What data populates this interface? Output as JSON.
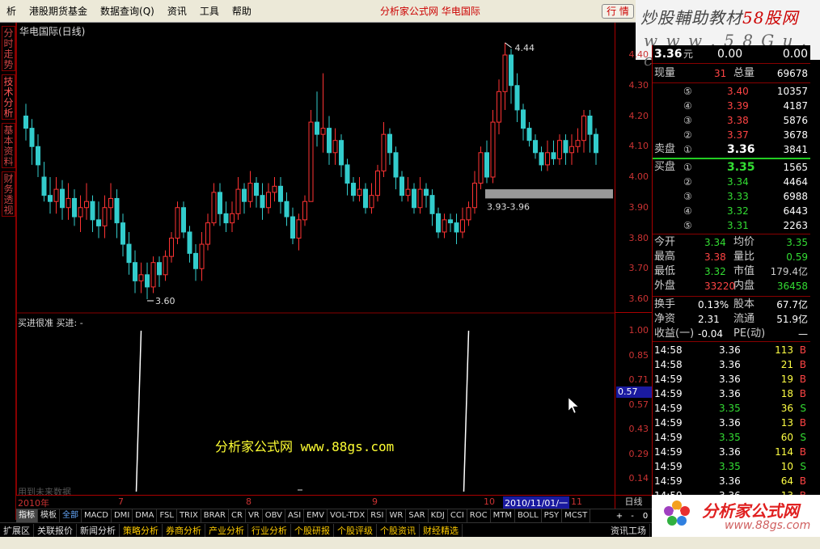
{
  "menu": {
    "items": [
      "析",
      "港股期货基金",
      "数据查询(Q)",
      "资讯",
      "工具",
      "帮助"
    ],
    "title": "分析家公式网  华电国际",
    "quote_button": "行 情"
  },
  "top_logo": {
    "line1_a": "炒股輔助教材",
    "line1_b": "58股网",
    "line2": "w w w . 5 8 G u . c o m"
  },
  "left_tabs": [
    "分时走势",
    "技术分析",
    "基本资料",
    "财务透视"
  ],
  "chart": {
    "title": "华电国际(日线)",
    "high_label": "4.44",
    "low_label": "3.60",
    "box_label": "3.93-3.96",
    "indicator_title": "买进很准 买进: -",
    "watermark_a": "分析家公式网 ",
    "watermark_b": "www.88gs.com",
    "future_note": "用到未来数据",
    "indicator_marker": "0.57",
    "colors": {
      "up": "#ff3333",
      "down": "#33cccc",
      "box": "#999999",
      "line": "#ffffff",
      "grid": "#880000"
    }
  },
  "chart_data": {
    "type": "candlestick",
    "price_axis": [
      "4.40",
      "4.30",
      "4.20",
      "4.10",
      "4.00",
      "3.90",
      "3.80",
      "3.70",
      "3.60"
    ],
    "indicator_axis": [
      "1.00",
      "0.85",
      "0.71",
      "0.57",
      "0.43",
      "0.29",
      "0.14"
    ],
    "x_labels": [
      "2010年",
      "7",
      "8",
      "9",
      "10",
      "11"
    ],
    "date_label": "2010/11/01/一",
    "period": "日线",
    "candles": [
      [
        4.2,
        4.16,
        4.24,
        4.12
      ],
      [
        4.16,
        4.1,
        4.19,
        4.04
      ],
      [
        4.1,
        4.04,
        4.14,
        4.0
      ],
      [
        4.0,
        3.94,
        4.05,
        3.92
      ],
      [
        3.94,
        3.92,
        4.0,
        3.88
      ],
      [
        3.92,
        3.96,
        4.0,
        3.88
      ],
      [
        3.96,
        3.9,
        3.99,
        3.86
      ],
      [
        3.9,
        3.93,
        3.98,
        3.86
      ],
      [
        3.93,
        3.87,
        3.96,
        3.84
      ],
      [
        3.87,
        3.9,
        3.94,
        3.82
      ],
      [
        3.9,
        3.92,
        3.98,
        3.86
      ],
      [
        3.92,
        3.86,
        3.94,
        3.82
      ],
      [
        3.86,
        3.84,
        3.92,
        3.8
      ],
      [
        3.84,
        3.9,
        3.94,
        3.8
      ],
      [
        3.9,
        3.93,
        3.98,
        3.86
      ],
      [
        3.93,
        3.85,
        3.96,
        3.8
      ],
      [
        3.85,
        3.78,
        3.88,
        3.74
      ],
      [
        3.78,
        3.72,
        3.82,
        3.68
      ],
      [
        3.72,
        3.66,
        3.76,
        3.62
      ],
      [
        3.66,
        3.68,
        3.72,
        3.62
      ],
      [
        3.68,
        3.64,
        3.72,
        3.6
      ],
      [
        3.64,
        3.72,
        3.74,
        3.62
      ],
      [
        3.72,
        3.68,
        3.74,
        3.64
      ],
      [
        3.68,
        3.74,
        3.76,
        3.66
      ],
      [
        3.74,
        3.8,
        3.82,
        3.72
      ],
      [
        3.8,
        3.9,
        3.92,
        3.78
      ],
      [
        3.9,
        3.82,
        3.92,
        3.8
      ],
      [
        3.82,
        3.75,
        3.84,
        3.72
      ],
      [
        3.75,
        3.7,
        3.78,
        3.66
      ],
      [
        3.7,
        3.78,
        3.82,
        3.66
      ],
      [
        3.78,
        3.85,
        3.88,
        3.76
      ],
      [
        3.85,
        3.95,
        3.98,
        3.84
      ],
      [
        3.95,
        3.88,
        3.98,
        3.84
      ],
      [
        3.88,
        3.85,
        3.92,
        3.82
      ],
      [
        3.85,
        3.88,
        3.92,
        3.82
      ],
      [
        3.88,
        3.96,
        4.0,
        3.86
      ],
      [
        3.96,
        3.92,
        3.98,
        3.88
      ],
      [
        3.92,
        3.98,
        4.02,
        3.9
      ],
      [
        3.98,
        3.94,
        4.0,
        3.9
      ],
      [
        3.94,
        3.9,
        3.98,
        3.86
      ],
      [
        3.9,
        3.95,
        3.98,
        3.88
      ],
      [
        3.95,
        3.97,
        4.0,
        3.92
      ],
      [
        3.97,
        3.92,
        4.0,
        3.88
      ],
      [
        3.92,
        3.87,
        3.95,
        3.84
      ],
      [
        3.87,
        3.8,
        3.9,
        3.78
      ],
      [
        3.8,
        3.86,
        3.88,
        3.76
      ],
      [
        3.86,
        3.92,
        3.94,
        3.84
      ],
      [
        3.92,
        4.18,
        4.22,
        3.92
      ],
      [
        4.18,
        4.14,
        4.28,
        4.1
      ],
      [
        4.14,
        4.16,
        4.34,
        4.08
      ],
      [
        4.16,
        4.08,
        4.2,
        4.04
      ],
      [
        4.08,
        4.12,
        4.16,
        4.04
      ],
      [
        4.12,
        4.04,
        4.14,
        4.0
      ],
      [
        4.04,
        3.98,
        4.06,
        3.94
      ],
      [
        3.98,
        3.94,
        4.0,
        3.92
      ],
      [
        3.94,
        3.96,
        4.0,
        3.92
      ],
      [
        3.96,
        3.9,
        3.98,
        3.88
      ],
      [
        3.9,
        3.94,
        3.98,
        3.88
      ],
      [
        3.94,
        4.02,
        4.04,
        3.92
      ],
      [
        4.02,
        4.14,
        4.18,
        4.0
      ],
      [
        4.14,
        4.08,
        4.16,
        4.04
      ],
      [
        4.08,
        4.0,
        4.1,
        3.96
      ],
      [
        4.0,
        3.94,
        4.02,
        3.92
      ],
      [
        3.94,
        3.96,
        4.0,
        3.92
      ],
      [
        3.96,
        3.9,
        3.98,
        3.88
      ],
      [
        3.9,
        3.96,
        4.0,
        3.88
      ],
      [
        3.96,
        3.94,
        3.98,
        3.9
      ],
      [
        3.94,
        3.88,
        3.96,
        3.84
      ],
      [
        3.88,
        3.82,
        3.9,
        3.8
      ],
      [
        3.82,
        3.86,
        3.88,
        3.8
      ],
      [
        3.86,
        3.85,
        3.88,
        3.82
      ],
      [
        3.85,
        3.82,
        3.88,
        3.78
      ],
      [
        3.82,
        3.86,
        3.9,
        3.8
      ],
      [
        3.86,
        3.9,
        3.92,
        3.84
      ],
      [
        3.9,
        3.98,
        4.02,
        3.88
      ],
      [
        3.98,
        4.08,
        4.1,
        3.96
      ],
      [
        4.08,
        4.0,
        4.12,
        3.98
      ],
      [
        4.0,
        4.18,
        4.22,
        3.98
      ],
      [
        4.18,
        4.28,
        4.32,
        4.14
      ],
      [
        4.28,
        4.4,
        4.44,
        4.22
      ],
      [
        4.4,
        4.3,
        4.42,
        4.24
      ],
      [
        4.3,
        4.22,
        4.34,
        4.18
      ],
      [
        4.22,
        4.16,
        4.24,
        4.12
      ],
      [
        4.16,
        4.12,
        4.18,
        4.1
      ],
      [
        4.12,
        4.08,
        4.14,
        4.06
      ],
      [
        4.08,
        4.04,
        4.1,
        4.02
      ],
      [
        4.04,
        4.08,
        4.12,
        4.02
      ],
      [
        4.08,
        4.06,
        4.12,
        4.04
      ],
      [
        4.06,
        4.12,
        4.14,
        4.04
      ],
      [
        4.12,
        4.08,
        4.14,
        4.04
      ],
      [
        4.08,
        4.1,
        4.14,
        4.04
      ],
      [
        4.1,
        4.12,
        4.16,
        4.08
      ],
      [
        4.12,
        4.2,
        4.22,
        4.08
      ],
      [
        4.2,
        4.14,
        4.22,
        4.08
      ],
      [
        4.14,
        4.08,
        4.16,
        4.04
      ]
    ],
    "signal_spikes": [
      {
        "x_index": 19
      },
      {
        "x_index": 73
      }
    ]
  },
  "indicator_bar": {
    "items": [
      "指标",
      "模板",
      "全部",
      "MACD",
      "DMI",
      "DMA",
      "FSL",
      "TRIX",
      "BRAR",
      "CR",
      "VR",
      "OBV",
      "ASI",
      "EMV",
      "VOL-TDX",
      "RSI",
      "WR",
      "SAR",
      "KDJ",
      "CCI",
      "ROC",
      "MTM",
      "BOLL",
      "PSY",
      "MCST"
    ],
    "controls": [
      "+",
      "-",
      "0"
    ]
  },
  "bottom_bar": {
    "items": [
      "扩展区",
      "关联报价",
      "新闻分析",
      "策略分析",
      "券商分析",
      "产业分析",
      "行业分析",
      "个股研报",
      "个股评级",
      "个股资讯",
      "财经精选"
    ],
    "right": "资讯工场"
  },
  "quote": {
    "price": "3.36",
    "unit": "元",
    "change": "0.00",
    "pct": "0.00",
    "now_label": "现量",
    "now_val": "31",
    "total_label": "总量",
    "total_val": "69678",
    "asks": [
      {
        "lv": "⑤",
        "p": "3.40",
        "v": "10357"
      },
      {
        "lv": "④",
        "p": "3.39",
        "v": "4187"
      },
      {
        "lv": "③",
        "p": "3.38",
        "v": "5876"
      },
      {
        "lv": "②",
        "p": "3.37",
        "v": "3678"
      },
      {
        "lv": "①",
        "p": "3.36",
        "v": "3841"
      }
    ],
    "ask_label": "卖盘",
    "bid_label": "买盘",
    "bids": [
      {
        "lv": "①",
        "p": "3.35",
        "v": "1565"
      },
      {
        "lv": "②",
        "p": "3.34",
        "v": "4464"
      },
      {
        "lv": "③",
        "p": "3.33",
        "v": "6988"
      },
      {
        "lv": "④",
        "p": "3.32",
        "v": "6443"
      },
      {
        "lv": "⑤",
        "p": "3.31",
        "v": "2263"
      }
    ],
    "stats": [
      {
        "l1": "今开",
        "v1": "3.34",
        "c1": "grn",
        "l2": "均价",
        "v2": "3.35",
        "c2": "grn"
      },
      {
        "l1": "最高",
        "v1": "3.38",
        "c1": "red",
        "l2": "量比",
        "v2": "0.59",
        "c2": "grn"
      },
      {
        "l1": "最低",
        "v1": "3.32",
        "c1": "grn",
        "l2": "市值",
        "v2": "179.4亿",
        "c2": "gry"
      },
      {
        "l1": "外盘",
        "v1": "33220",
        "c1": "red",
        "l2": "内盘",
        "v2": "36458",
        "c2": "grn"
      }
    ],
    "stats2": [
      {
        "l1": "换手",
        "v1": "0.13%",
        "l2": "股本",
        "v2": "67.7亿"
      },
      {
        "l1": "净资",
        "v1": "2.31",
        "l2": "流通",
        "v2": "51.9亿"
      },
      {
        "l1": "收益(一)",
        "v1": "-0.04",
        "l2": "PE(动)",
        "v2": "—"
      }
    ],
    "ticks": [
      {
        "t": "14:58",
        "p": "3.36",
        "pc": "wht",
        "v": "113",
        "s": "B"
      },
      {
        "t": "14:58",
        "p": "3.36",
        "pc": "wht",
        "v": "21",
        "s": "B"
      },
      {
        "t": "14:59",
        "p": "3.36",
        "pc": "wht",
        "v": "19",
        "s": "B"
      },
      {
        "t": "14:59",
        "p": "3.36",
        "pc": "wht",
        "v": "18",
        "s": "B"
      },
      {
        "t": "14:59",
        "p": "3.35",
        "pc": "grn",
        "v": "36",
        "s": "S"
      },
      {
        "t": "14:59",
        "p": "3.36",
        "pc": "wht",
        "v": "13",
        "s": "B"
      },
      {
        "t": "14:59",
        "p": "3.35",
        "pc": "grn",
        "v": "60",
        "s": "S"
      },
      {
        "t": "14:59",
        "p": "3.36",
        "pc": "wht",
        "v": "114",
        "s": "B"
      },
      {
        "t": "14:59",
        "p": "3.35",
        "pc": "grn",
        "v": "10",
        "s": "S"
      },
      {
        "t": "14:59",
        "p": "3.36",
        "pc": "wht",
        "v": "64",
        "s": "B"
      },
      {
        "t": "14:59",
        "p": "3.36",
        "pc": "wht",
        "v": "13",
        "s": "B"
      }
    ]
  },
  "bottom_logo": {
    "title": "分析家公式网",
    "url": "www.88gs.com"
  }
}
